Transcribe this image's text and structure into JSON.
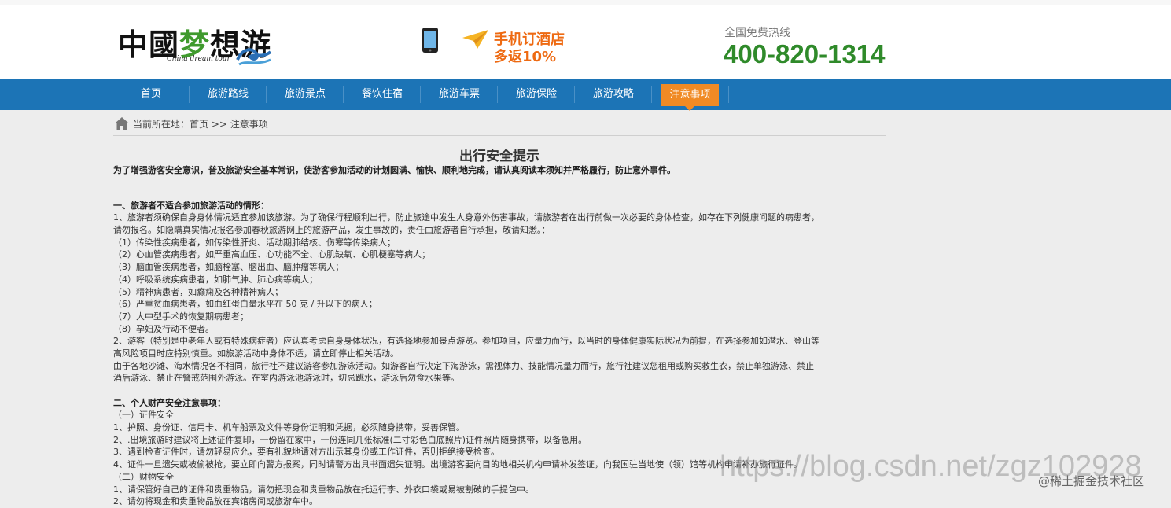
{
  "header": {
    "logo_text": "中國梦想游",
    "logo_subtitle": "China dream tour",
    "promo_line1": "手机订酒店",
    "promo_line2": "多返10%",
    "hotline_label": "全国免费热线",
    "hotline_number": "400-820-1314"
  },
  "nav": {
    "items": [
      {
        "label": "首页"
      },
      {
        "label": "旅游路线"
      },
      {
        "label": "旅游景点"
      },
      {
        "label": "餐饮住宿"
      },
      {
        "label": "旅游车票"
      },
      {
        "label": "旅游保险"
      },
      {
        "label": "旅游攻略"
      },
      {
        "label": "注意事项"
      }
    ],
    "active_index": 7,
    "colors": {
      "bar": "#1c74b6",
      "active": "#f08a24"
    }
  },
  "breadcrumb": {
    "text": "当前所在地：首页 >> 注意事项",
    "icon": "home-icon"
  },
  "article": {
    "title": "出行安全提示",
    "intro": "为了增强游客安全意识，普及旅游安全基本常识，使游客参加活动的计划圆满、愉快、顺利地完成，请认真阅读本须知并严格履行，防止意外事件。",
    "lines": [
      {
        "text": "",
        "style": "blank"
      },
      {
        "text": "一、旅游者不适合参加旅游活动的情形：",
        "style": "bold"
      },
      {
        "text": "1、旅游者须确保自身身体情况适宜参加该旅游。为了确保行程顺利出行，防止旅途中发生人身意外伤害事故，请旅游者在出行前做一次必要的身体检查，如存在下列健康问题的病患者，",
        "style": "normal"
      },
      {
        "text": "请勿报名。如隐瞒真实情况报名参加春秋旅游网上的旅游产品，发生事故的，责任由旅游者自行承担，敬请知悉。：",
        "style": "normal"
      },
      {
        "text": "（1）传染性疾病患者，如传染性肝炎、活动期肺结核、伤寒等传染病人；",
        "style": "normal"
      },
      {
        "text": "（2）心血管疾病患者，如严重高血压、心功能不全、心肌缺氧、心肌梗塞等病人；",
        "style": "normal"
      },
      {
        "text": "（3）脑血管疾病患者，如脑栓塞、脑出血、脑肿瘤等病人；",
        "style": "normal"
      },
      {
        "text": "（4）呼吸系统疾病患者，如肺气肿、肺心病等病人；",
        "style": "normal"
      },
      {
        "text": "（5）精神病患者，如癫痫及各种精神病人；",
        "style": "normal"
      },
      {
        "text": "（6）严重贫血病患者，如血红蛋白量水平在 50 克 / 升以下的病人；",
        "style": "normal"
      },
      {
        "text": "（7）大中型手术的恢复期病患者；",
        "style": "normal"
      },
      {
        "text": "（8）孕妇及行动不便者。",
        "style": "normal"
      },
      {
        "text": "2、游客（特别是中老年人或有特殊病症者）应认真考虑自身身体状况，有选择地参加景点游览。参加项目，应量力而行，以当时的身体健康实际状况为前提，在选择参加如潜水、登山等",
        "style": "normal"
      },
      {
        "text": "高风险项目时应特别慎重。如旅游活动中身体不适，请立即停止相关活动。",
        "style": "normal"
      },
      {
        "text": "由于各地沙滩、海水情况各不相同，旅行社不建议游客参加游泳活动。如游客自行决定下海游泳，需视体力、技能情况量力而行，旅行社建议您租用或购买救生衣，禁止单独游泳、禁止",
        "style": "normal"
      },
      {
        "text": "酒后游泳、禁止在警戒范围外游泳。在室内游泳池游泳时，切忌跳水，游泳后勿食水果等。",
        "style": "normal"
      },
      {
        "text": "",
        "style": "blank"
      },
      {
        "text": "二、个人财产安全注意事项：",
        "style": "bold"
      },
      {
        "text": "（一）证件安全",
        "style": "normal"
      },
      {
        "text": "1、护照、身份证、信用卡、机车船票及文件等身份证明和凭据，必须随身携带，妥善保管。",
        "style": "normal"
      },
      {
        "text": "2、.出境旅游时建议将上述证件复印，一份留在家中，一份连同几张标准(二寸彩色白底照片)证件照片随身携带，以备急用。",
        "style": "normal"
      },
      {
        "text": "3、遇到检查证件时，请勿轻易应允，要有礼貌地请对方出示其身份或工作证件，否则拒绝接受检查。",
        "style": "normal"
      },
      {
        "text": "4、证件一旦遗失或被偷被抢，要立即向警方报案，同时请警方出具书面遗失证明。出境游客要向目的地相关机构申请补发签证，向我国驻当地使（领）馆等机构申请补办旅行证件。",
        "style": "normal"
      },
      {
        "text": "（二）财物安全",
        "style": "normal"
      },
      {
        "text": "1、请保管好自己的证件和贵重物品，请勿把现金和贵重物品放在托运行李、外衣口袋或易被割破的手提包中。",
        "style": "normal"
      },
      {
        "text": "2、请勿将现金和贵重物品放在宾馆房间或旅游车中。",
        "style": "normal"
      }
    ]
  },
  "watermark": {
    "url_text": "https://blog.csdn.net/zgz102928",
    "site_text": "@稀土掘金技术社区"
  }
}
